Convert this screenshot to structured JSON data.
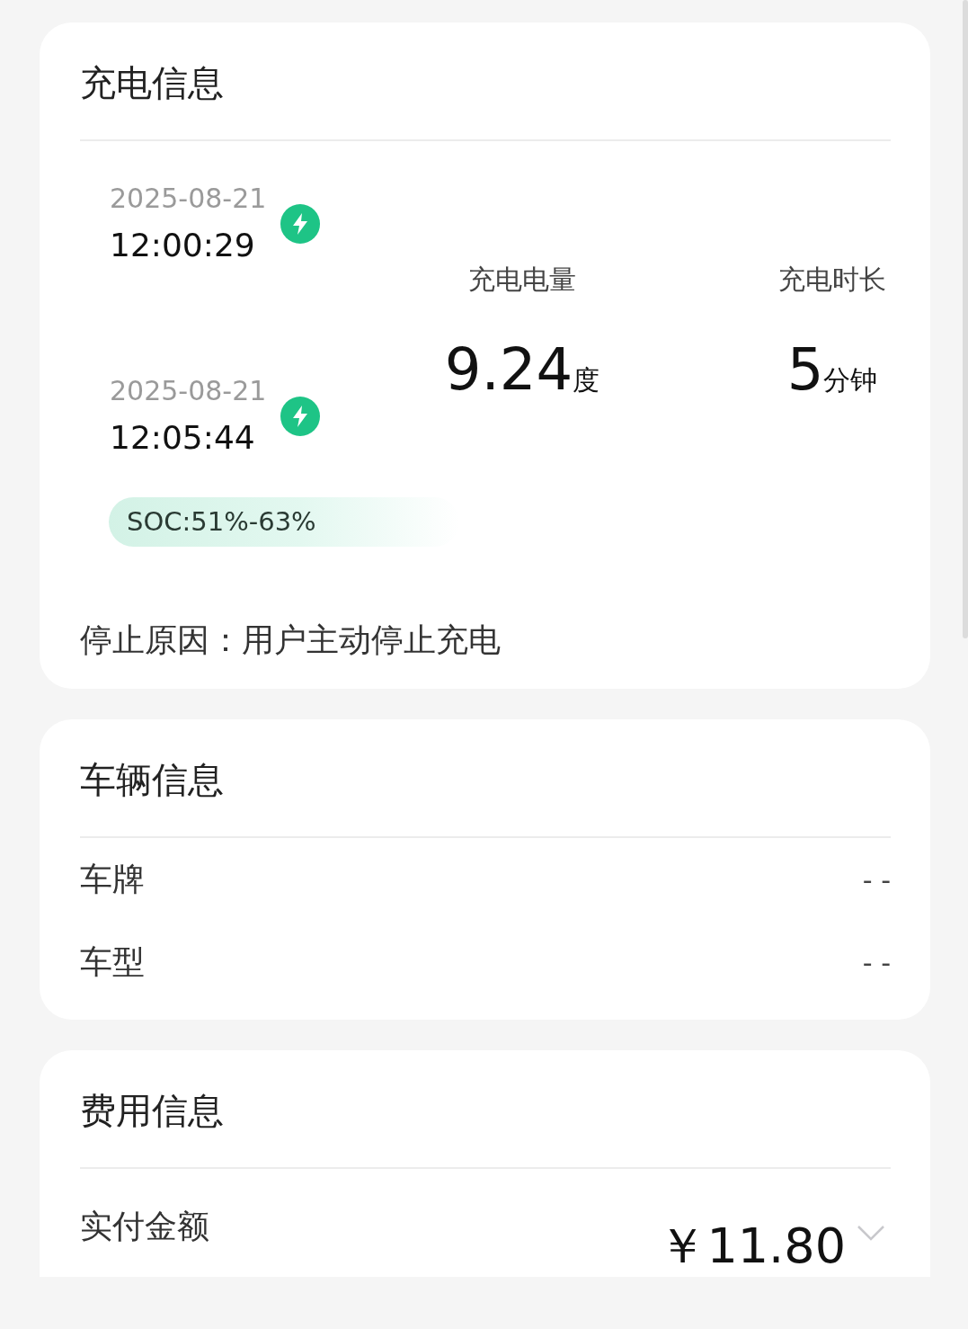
{
  "charging_info": {
    "title": "充电信息",
    "sessions": [
      {
        "date": "2025-08-21",
        "time": "12:00:29"
      },
      {
        "date": "2025-08-21",
        "time": "12:05:44"
      }
    ],
    "soc": "SOC:51%-63%",
    "stats": [
      {
        "label": "充电电量",
        "value": "9.24",
        "unit": "度"
      },
      {
        "label": "充电时长",
        "value": "5",
        "unit": "分钟"
      }
    ],
    "stop_reason": "停止原因：用户主动停止充电"
  },
  "vehicle_info": {
    "title": "车辆信息",
    "rows": [
      {
        "label": "车牌",
        "value": "- -"
      },
      {
        "label": "车型",
        "value": "- -"
      }
    ]
  },
  "fee_info": {
    "title": "费用信息",
    "rows": [
      {
        "label": "实付金额",
        "value": "￥11.80",
        "expanded": false
      }
    ]
  }
}
